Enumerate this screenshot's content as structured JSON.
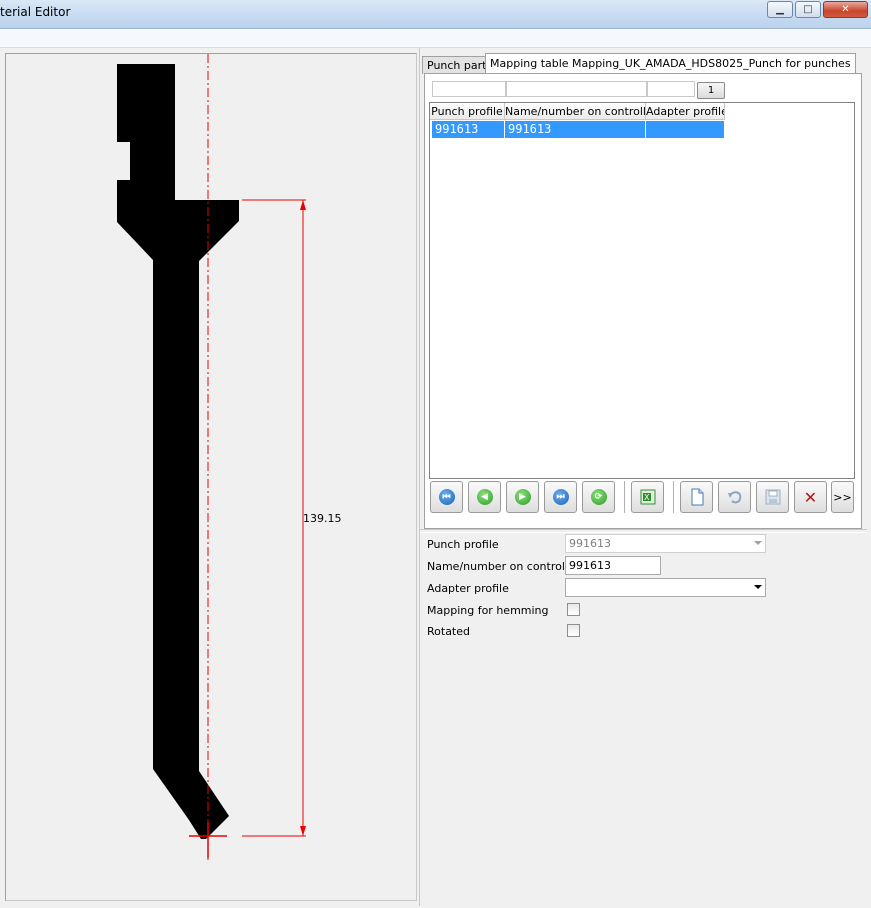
{
  "window": {
    "title": "terial Editor",
    "controls": {
      "minimize": "▁",
      "maximize": "□",
      "close": "✕"
    }
  },
  "drawing": {
    "dimension_value": "139.15"
  },
  "tabs": [
    {
      "label": "Punch parts"
    },
    {
      "label": "Mapping table Mapping_UK_AMADA_HDS8025_Punch for punches"
    }
  ],
  "filter": {
    "page_number": "1"
  },
  "table": {
    "columns": [
      "Punch profile",
      "Name/number on controller",
      "Adapter profile"
    ],
    "rows": [
      {
        "punch_profile": "991613",
        "name_on_controller": "991613",
        "adapter_profile": ""
      }
    ]
  },
  "toolbar": {
    "icons": [
      "first-record-icon",
      "previous-record-icon",
      "next-record-icon",
      "last-record-icon",
      "refresh-icon",
      "export-excel-icon",
      "new-record-icon",
      "undo-icon",
      "save-icon",
      "delete-icon",
      "more-icon"
    ],
    "more_label": ">>",
    "delete_label": "✕"
  },
  "form": {
    "punch_profile": {
      "label": "Punch profile",
      "value": "991613"
    },
    "name_on_controller": {
      "label": "Name/number on controller",
      "value": "991613"
    },
    "adapter_profile": {
      "label": "Adapter profile",
      "value": ""
    },
    "mapping_for_hemming": {
      "label": "Mapping for hemming",
      "checked": false
    },
    "rotated": {
      "label": "Rotated",
      "checked": false
    }
  }
}
